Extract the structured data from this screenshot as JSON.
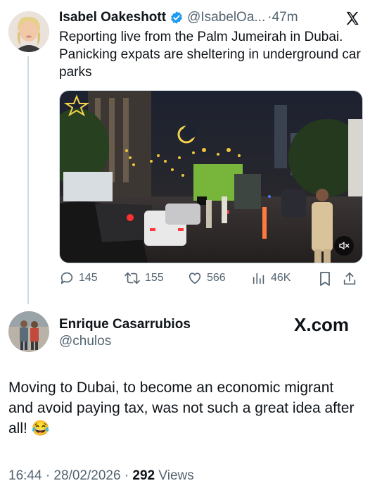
{
  "quoted_tweet": {
    "author_name": "Isabel Oakeshott",
    "handle": "@IsabelOa...",
    "separator": "·",
    "time_ago": "47m",
    "text": "Reporting live from the Palm Jumeirah in Dubai. Panicking expats are sheltering in underground car parks",
    "actions": {
      "replies": "145",
      "reposts": "155",
      "likes": "566",
      "views": "46K"
    }
  },
  "reply_tweet": {
    "author_name": "Enrique Casarrubios",
    "handle": "@chulos",
    "watermark": "X.com",
    "text": "Moving to Dubai, to become an economic migrant and avoid paying tax, was not such a great idea after all! 😂",
    "timestamp": "16:44 · 28/02/2026 ·",
    "views_count": "292",
    "views_label": "Views"
  },
  "colors": {
    "verified": "#1d9bf0",
    "secondary_text": "#536471",
    "thread_line": "#cfd9de"
  }
}
